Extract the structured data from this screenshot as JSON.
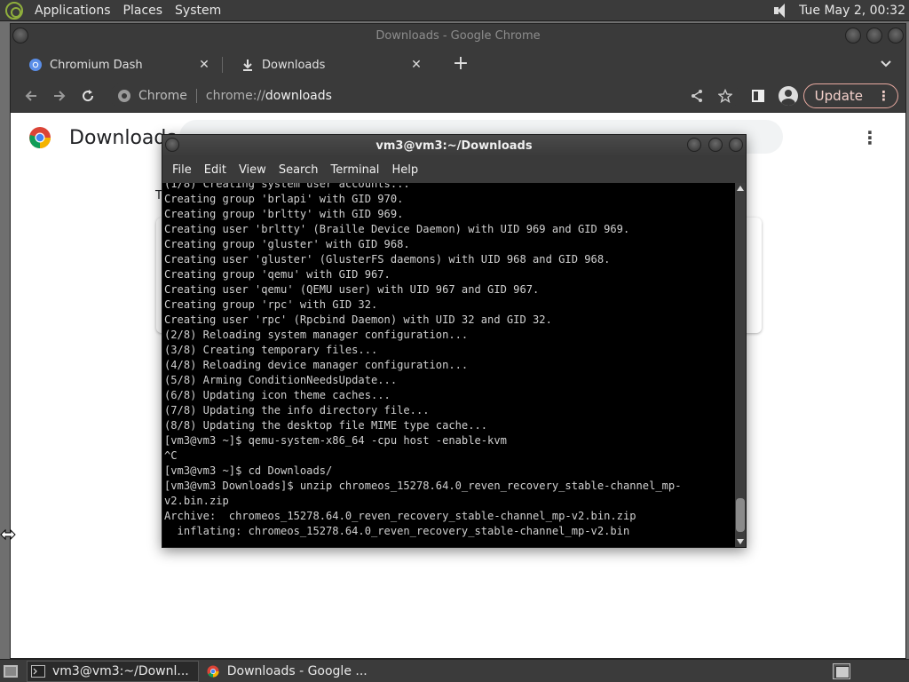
{
  "top_panel": {
    "menus": [
      "Applications",
      "Places",
      "System"
    ],
    "clock": "Tue May  2, 00:32"
  },
  "chrome": {
    "window_title": "Downloads - Google Chrome",
    "tabs": [
      {
        "label": "Chromium Dash",
        "close": "✕"
      },
      {
        "label": "Downloads",
        "close": "✕"
      }
    ],
    "new_tab": "+",
    "omnibox": {
      "site_label": "Chrome",
      "url_scheme": "chrome://",
      "url_host": "downloads"
    },
    "update_label": "Update",
    "update_menu": "⋮"
  },
  "downloads_page": {
    "title": "Downloads",
    "partial_date": "T",
    "more_menu": "⋮"
  },
  "terminal": {
    "title": "vm3@vm3:~/Downloads",
    "menus": [
      "File",
      "Edit",
      "View",
      "Search",
      "Terminal",
      "Help"
    ],
    "output": "(1/8) Creating system user accounts...\nCreating group 'brlapi' with GID 970.\nCreating group 'brltty' with GID 969.\nCreating user 'brltty' (Braille Device Daemon) with UID 969 and GID 969.\nCreating group 'gluster' with GID 968.\nCreating user 'gluster' (GlusterFS daemons) with UID 968 and GID 968.\nCreating group 'qemu' with GID 967.\nCreating user 'qemu' (QEMU user) with UID 967 and GID 967.\nCreating group 'rpc' with GID 32.\nCreating user 'rpc' (Rpcbind Daemon) with UID 32 and GID 32.\n(2/8) Reloading system manager configuration...\n(3/8) Creating temporary files...\n(4/8) Reloading device manager configuration...\n(5/8) Arming ConditionNeedsUpdate...\n(6/8) Updating icon theme caches...\n(7/8) Updating the info directory file...\n(8/8) Updating the desktop file MIME type cache...\n[vm3@vm3 ~]$ qemu-system-x86_64 -cpu host -enable-kvm\n^C\n[vm3@vm3 ~]$ cd Downloads/\n[vm3@vm3 Downloads]$ unzip chromeos_15278.64.0_reven_recovery_stable-channel_mp-\nv2.bin.zip\nArchive:  chromeos_15278.64.0_reven_recovery_stable-channel_mp-v2.bin.zip\n  inflating: chromeos_15278.64.0_reven_recovery_stable-channel_mp-v2.bin"
  },
  "taskbar": {
    "tasks": [
      {
        "label": "vm3@vm3:~/Downl..."
      },
      {
        "label": "Downloads - Google ..."
      }
    ]
  },
  "colors": {
    "panel_bg": "#3b3b3b",
    "chrome_frame": "#3a3a3a",
    "terminal_bg": "#000000",
    "terminal_fg": "#d0d0d0",
    "update_accent": "#e8a9a0"
  }
}
